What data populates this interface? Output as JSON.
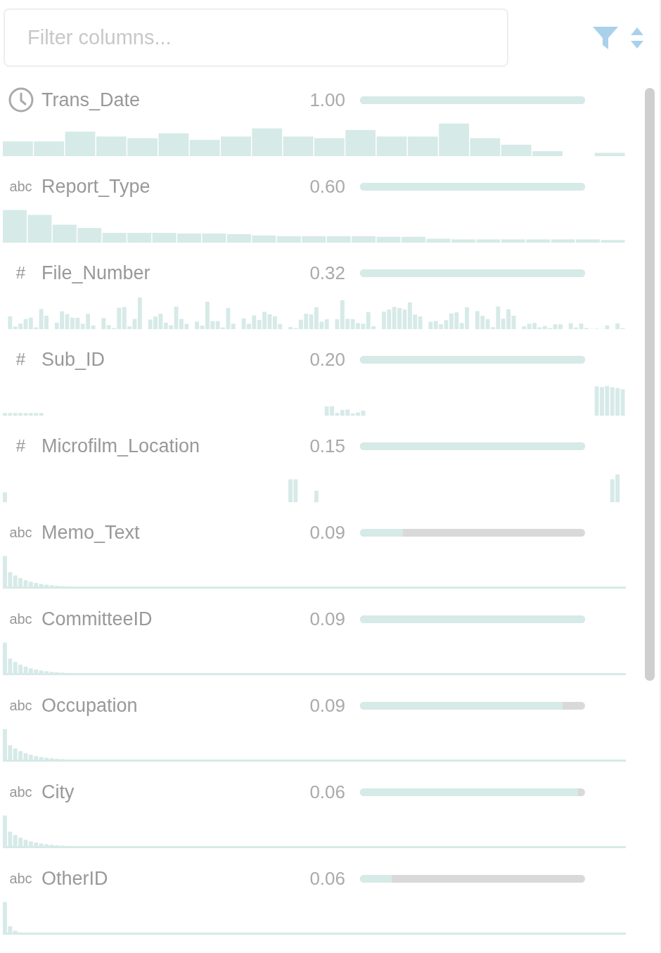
{
  "filter": {
    "placeholder": "Filter columns..."
  },
  "columns": [
    {
      "kind": "date",
      "name": "Trans_Date",
      "score": "1.00",
      "level": 1
    },
    {
      "kind": "text",
      "glyph": "abc",
      "name": "Report_Type",
      "score": "0.60",
      "level": 1
    },
    {
      "kind": "number",
      "glyph": "#",
      "name": "File_Number",
      "score": "0.32",
      "level": 1
    },
    {
      "kind": "number",
      "glyph": "#",
      "name": "Sub_ID",
      "score": "0.20",
      "level": 1
    },
    {
      "kind": "number",
      "glyph": "#",
      "name": "Microfilm_Location",
      "score": "0.15",
      "level": 1
    },
    {
      "kind": "text",
      "glyph": "abc",
      "name": "Memo_Text",
      "score": "0.09",
      "level": 0.19
    },
    {
      "kind": "text",
      "glyph": "abc",
      "name": "CommitteeID",
      "score": "0.09",
      "level": 1
    },
    {
      "kind": "text",
      "glyph": "abc",
      "name": "Occupation",
      "score": "0.09",
      "level": 0.9
    },
    {
      "kind": "text",
      "glyph": "abc",
      "name": "City",
      "score": "0.06",
      "level": 0.97
    },
    {
      "kind": "text",
      "glyph": "abc",
      "name": "OtherID",
      "score": "0.06",
      "level": 0.14
    }
  ]
}
